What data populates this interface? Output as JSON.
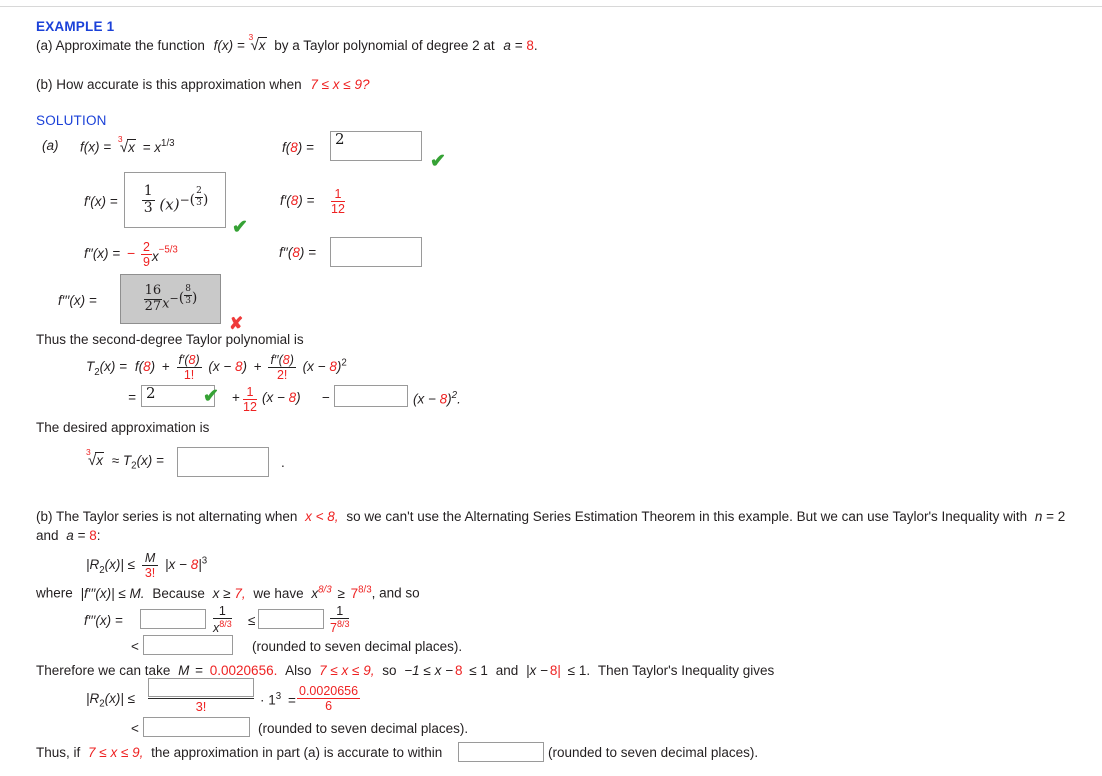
{
  "document": {
    "example_heading": "EXAMPLE 1",
    "solution_heading": "SOLUTION",
    "part_a_prompt_1": "(a) Approximate the function",
    "part_a_fx": "f(x) =",
    "part_a_radicand": "x",
    "part_a_root_index": "3",
    "part_a_prompt_2": "by a Taylor polynomial of degree 2 at",
    "part_a_at_var": "a =",
    "part_a_at_value": "8",
    "part_a_period": ".",
    "part_b_prompt": "(b) How accurate is this approximation when",
    "part_b_range": "7 ≤ x ≤ 9?",
    "label_a": "(a)"
  },
  "derivatives": {
    "f_label": "f(x)  =",
    "f_expr_eq": "= x",
    "f_expr_exp": "1/3",
    "fprime_label": "f′(x)  =",
    "fprime_answer": "(1/3)(x)^−(2/3)",
    "fprime_num": "1",
    "fprime_den": "3",
    "fprime_base": "(x)",
    "fprime_exp_num": "2",
    "fprime_exp_den": "3",
    "f2_label": "f′′(x)  =",
    "f2_minus": "−",
    "f2_num": "2",
    "f2_den": "9",
    "f2_var": "x",
    "f2_exp": "−5/3",
    "f3_label": "f′′′(x)  =",
    "f3_answer": "(16/27)x^−(8/3)",
    "f3_num": "16",
    "f3_den": "27",
    "f3_var": "x",
    "f3_exp_num": "8",
    "f3_exp_den": "3"
  },
  "values": {
    "f8_label": "f(8)  =",
    "f8_label_pre": "f(",
    "f8_label_arg": "8",
    "f8_label_post": ")  =",
    "f8_value": "2",
    "fprime8_label_pre": "f′(",
    "fprime8_label_arg": "8",
    "fprime8_label_post": ")  =",
    "fprime8_num": "1",
    "fprime8_den": "12",
    "f28_label_pre": "f′′(",
    "f28_label_arg": "8",
    "f28_label_post": ")  =",
    "f28_value": ""
  },
  "taylor": {
    "intro": "Thus the second-degree Taylor polynomial is",
    "t2_label": "T",
    "t2_sub": "2",
    "t2_rest": "(x)  =",
    "term_f8_pre": "f(",
    "term_f8_arg": "8",
    "term_f8_post": ")",
    "plus": "+",
    "fr1_num_pre": "f′(",
    "fr1_num_arg": "8",
    "fr1_num_post": ")",
    "fr1_den": "1!",
    "x_minus_8_pre": "(x − ",
    "x_minus_8_arg": "8",
    "x_minus_8_post": ")",
    "fr2_num_pre": "f′′(",
    "fr2_num_arg": "8",
    "fr2_num_post": ")",
    "fr2_den": "2!",
    "squared": "2",
    "eq": "=",
    "answer_first": "2",
    "mid_plus": "+",
    "mid_frac_num": "1",
    "mid_frac_den": "12",
    "mid_tail_pre": "(x − ",
    "mid_tail_arg": "8",
    "mid_tail_post": ")",
    "minus": "−",
    "tail_pre": "(x − ",
    "tail_arg": "8",
    "tail_post": ")",
    "tail_sup": "2",
    "tail_period": ".",
    "approx_intro": "The desired approximation is",
    "approx_root_index": "3",
    "approx_radicand": "x",
    "approx_rel": "≈ T",
    "approx_sub": "2",
    "approx_rest": "(x)  =",
    "approx_value": "",
    "approx_period": "."
  },
  "part_b": {
    "para_1a": "(b) The Taylor series is not alternating when",
    "para_1b": "x < 8,",
    "para_1c": "so we can't use the Alternating Series Estimation Theorem in this example. But we can use Taylor's Inequality with",
    "para_1d": "n",
    "para_1e": "= 2",
    "para_2a": "and",
    "para_2b": "a",
    "para_2c": "=",
    "para_2d": "8",
    "para_2e": ":",
    "ineq_lhs_pre": "|R",
    "ineq_lhs_sub": "2",
    "ineq_lhs_post": "(x)|  ≤",
    "ineq_num": "M",
    "ineq_den": "3!",
    "ineq_tail_pre": "|x − ",
    "ineq_tail_arg": "8",
    "ineq_tail_post": "|",
    "ineq_tail_sup": "3",
    "where_a": "where",
    "where_b": "|f′′′(x)| ≤ M.",
    "where_c": "Because",
    "where_d": "x ≥ 7,",
    "where_e": "we have",
    "where_f_base": "x",
    "where_f_exp": "8/3",
    "where_g": "≥",
    "where_h_base": "7",
    "where_h_exp": "8/3",
    "where_i": ", and so",
    "f4_label": "f′′′(x)  =",
    "f4_box1": "",
    "f4_frac1_num": "1",
    "f4_frac1_den_base": "x",
    "f4_frac1_den_exp": "8/3",
    "f4_rel": "≤",
    "f4_box2": "",
    "f4_frac2_num": "1",
    "f4_frac2_den_base": "7",
    "f4_frac2_den_exp": "8/3",
    "f4_lt": "<",
    "f4_box3": "",
    "f4_note": "(rounded to seven decimal places).",
    "therefore_a": "Therefore we can take",
    "therefore_b": "M",
    "therefore_c": "=",
    "therefore_d": "0.0020656.",
    "therefore_e": "Also",
    "therefore_f": "7 ≤ x ≤ 9,",
    "therefore_g": "so",
    "therefore_h": "−1 ≤ x −",
    "therefore_i": "8",
    "therefore_j": "≤ 1",
    "therefore_k": "and",
    "therefore_l": "|x −",
    "therefore_m": "8|",
    "therefore_n": "≤ 1.",
    "therefore_o": "Then Taylor's Inequality gives",
    "final_lhs_pre": "|R",
    "final_lhs_sub": "2",
    "final_lhs_post": "(x)|  ≤",
    "final_box1": "",
    "final_den": "3!",
    "final_mid": "· 1",
    "final_mid_sup": "3",
    "final_eq": "=",
    "final_frac_num": "0.0020656",
    "final_frac_den": "6",
    "final_lt": "<",
    "final_box2": "",
    "final_note": "(rounded to seven decimal places).",
    "thus_a": "Thus, if",
    "thus_b": "7 ≤ x ≤ 9,",
    "thus_c": "the approximation in part (a) is accurate to within",
    "thus_box": "",
    "thus_d": "(rounded to seven decimal places)."
  },
  "grading": {
    "check_icon": "✔",
    "cross_icon": "✘",
    "check_color": "#36a235",
    "cross_color": "#ef3b3b",
    "correct_f8": "correct",
    "correct_fprime": "correct",
    "incorrect_f3": "incorrect",
    "correct_t2_first": "correct"
  }
}
